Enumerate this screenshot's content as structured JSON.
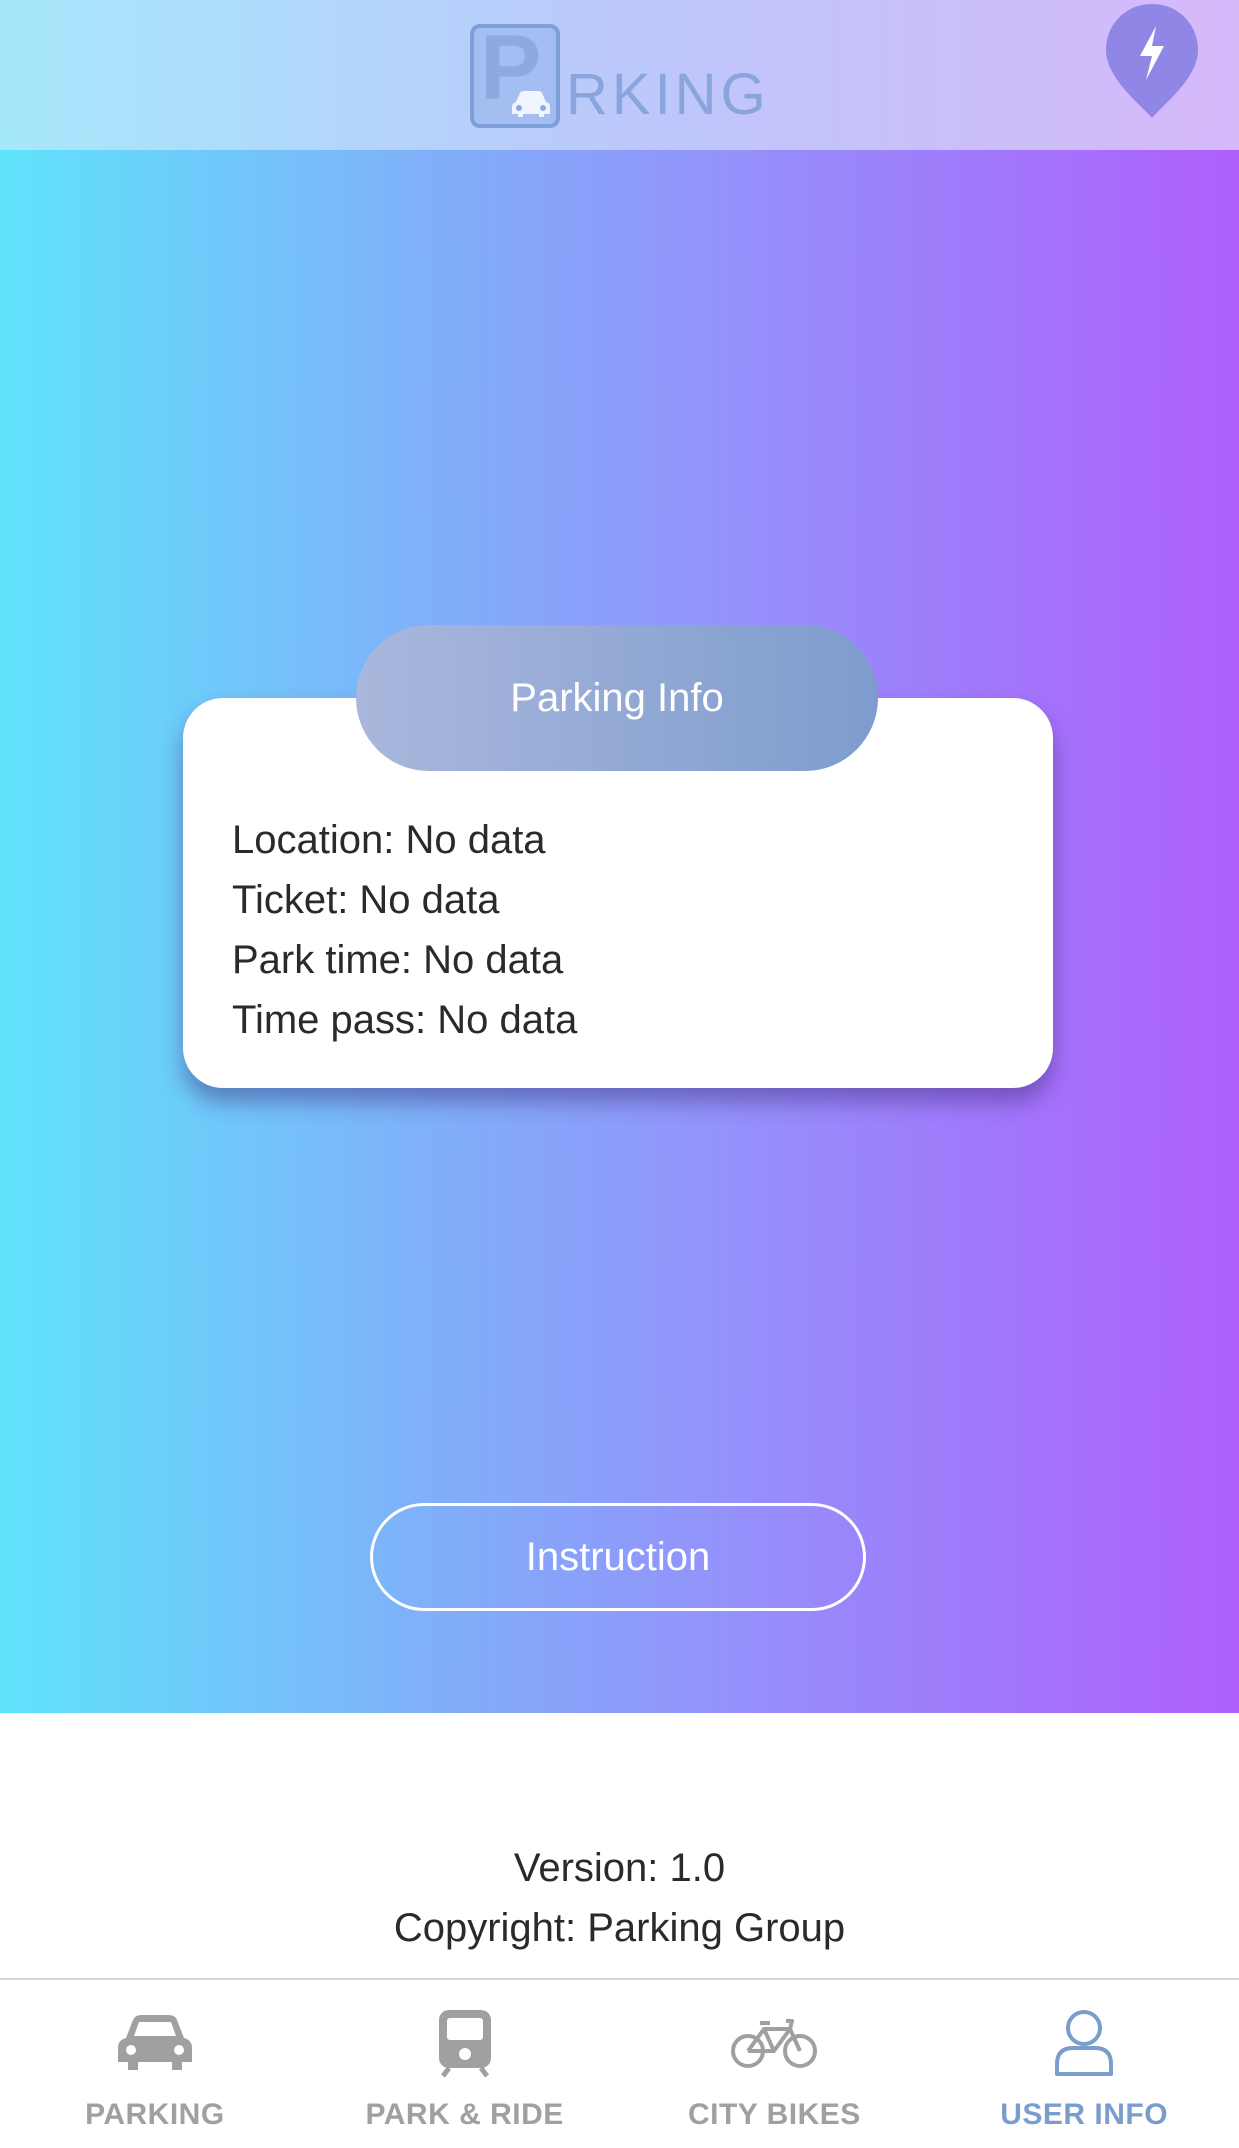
{
  "header": {
    "logo_text": "PARKING",
    "logo_rest": "RKING",
    "logo_first": "P",
    "action_icon": "lightning-pin-icon"
  },
  "card": {
    "title": "Parking Info",
    "lines": [
      "Location: No data",
      "Ticket: No data",
      "Park time: No data",
      "Time pass: No data"
    ]
  },
  "instruction_label": "Instruction",
  "about": {
    "version": "Version: 1.0",
    "copyright": "Copyright: Parking Group"
  },
  "tabs": [
    {
      "label": "PARKING",
      "icon": "car-icon",
      "active": false
    },
    {
      "label": "PARK & RIDE",
      "icon": "train-icon",
      "active": false
    },
    {
      "label": "CITY BIKES",
      "icon": "bike-icon",
      "active": false
    },
    {
      "label": "USER INFO",
      "icon": "user-icon",
      "active": true
    }
  ],
  "colors": {
    "gradient_left": "#5fe3fb",
    "gradient_right": "#ae5ffb",
    "active_tab": "#7b9dcb",
    "inactive_tab": "#a0a0a0"
  }
}
